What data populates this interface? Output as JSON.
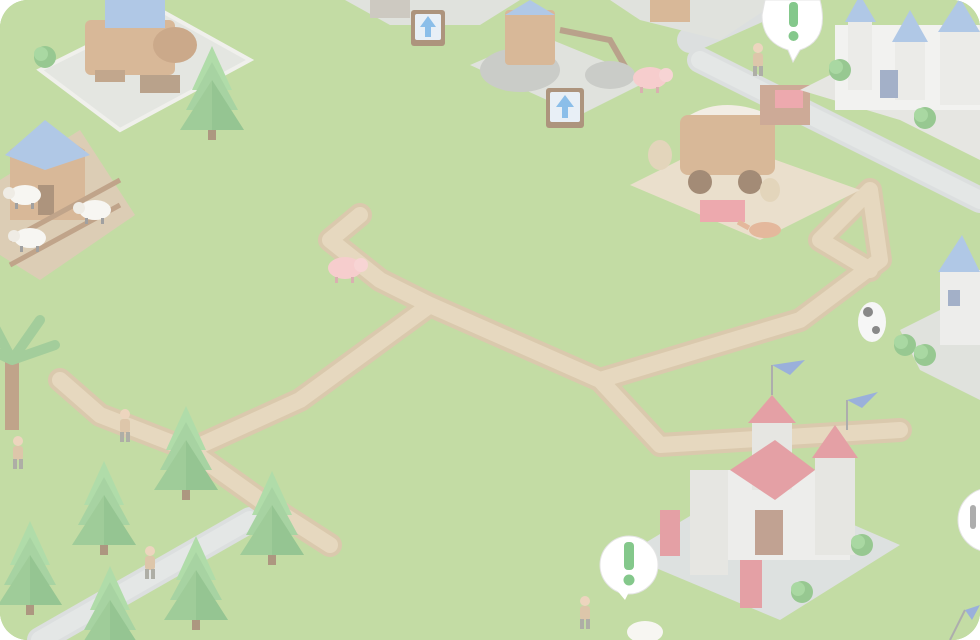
{
  "scene": {
    "type": "isometric-city-builder-map",
    "overlay": "faded",
    "colors": {
      "grass": "#a9cd7d",
      "grass_dark": "#98bf6c",
      "path": "#dcc8a4",
      "path_edge": "#cbb28a",
      "cobblestone": "#cfd4d3",
      "stone_wall": "#dcdcd6",
      "roof_red": "#d9787e",
      "roof_blue": "#8fb0dc",
      "wood": "#c89a6c",
      "tree": "#82c17a",
      "tree_dark": "#5fa55d",
      "quest_green": "#4fb05a",
      "upgrade_blue": "#5aa3e0"
    }
  },
  "markers": {
    "quest": [
      {
        "id": "quest-top-right",
        "icon": "exclamation-icon"
      },
      {
        "id": "quest-bottom",
        "icon": "exclamation-icon"
      }
    ],
    "upgrade": [
      {
        "id": "upgrade-top",
        "icon": "arrow-up-icon"
      },
      {
        "id": "upgrade-workshop",
        "icon": "arrow-up-icon"
      }
    ]
  },
  "buildings": [
    {
      "id": "sawmill",
      "icon": "sawmill-icon"
    },
    {
      "id": "farm-barn",
      "icon": "barn-icon"
    },
    {
      "id": "quarry-workshop",
      "icon": "workshop-icon"
    },
    {
      "id": "merchant-caravan",
      "icon": "caravan-icon"
    },
    {
      "id": "blue-castle",
      "icon": "castle-icon"
    },
    {
      "id": "red-castle",
      "icon": "castle-icon"
    },
    {
      "id": "blue-tower",
      "icon": "tower-icon"
    }
  ],
  "animals": [
    "pig",
    "pig",
    "sheep",
    "sheep",
    "cow",
    "fox"
  ]
}
